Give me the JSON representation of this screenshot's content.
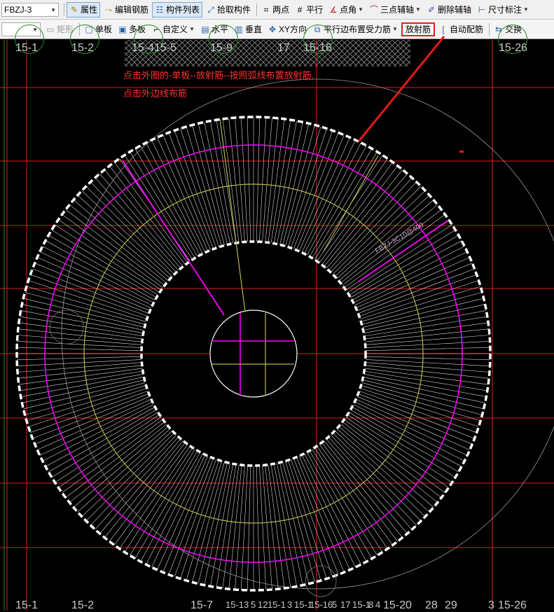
{
  "toolbar_top": {
    "component_select": "FBZJ-3",
    "buttons": [
      {
        "label": "属性",
        "icon": "properties-icon",
        "active": true
      },
      {
        "label": "编辑钢筋",
        "icon": "edit-rebar-icon",
        "active": false
      },
      {
        "label": "构件列表",
        "icon": "component-list-icon",
        "active": true
      },
      {
        "label": "拾取构件",
        "icon": "pick-component-icon",
        "active": false
      },
      {
        "label": "两点",
        "icon": "two-point-axis-icon",
        "active": false
      },
      {
        "label": "平行",
        "icon": "parallel-axis-icon",
        "active": false
      },
      {
        "label": "点角",
        "icon": "point-angle-axis-icon",
        "active": false
      },
      {
        "label": "三点辅轴",
        "icon": "three-point-axis-icon",
        "active": false
      },
      {
        "label": "删除辅轴",
        "icon": "delete-axis-icon",
        "active": false
      },
      {
        "label": "尺寸标注",
        "icon": "dimension-icon",
        "active": false
      }
    ]
  },
  "toolbar_bottom": {
    "shape_select": "",
    "buttons": [
      {
        "label": "矩形",
        "icon": "rectangle-icon",
        "disabled": true
      },
      {
        "label": "单板",
        "icon": "single-slab-icon"
      },
      {
        "label": "多板",
        "icon": "multi-slab-icon"
      },
      {
        "label": "自定义",
        "icon": "custom-icon"
      },
      {
        "label": "水平",
        "icon": "horizontal-icon"
      },
      {
        "label": "垂直",
        "icon": "vertical-icon"
      },
      {
        "label": "XY方向",
        "icon": "xy-direction-icon"
      },
      {
        "label": "平行边布置受力筋",
        "icon": "parallel-edge-icon"
      },
      {
        "label": "放射筋",
        "icon": "radial-rebar-icon",
        "highlighted": true
      },
      {
        "label": "自动配筋",
        "icon": "auto-rebar-icon"
      },
      {
        "label": "交换",
        "icon": "swap-icon"
      }
    ]
  },
  "canvas": {
    "axis_labels_top": [
      "15-1",
      "15-2",
      "15-4",
      "15-5",
      "15-9",
      "17",
      "15-16",
      "15-26"
    ],
    "axis_labels_bottom": [
      "15-1",
      "15-2",
      "15-7",
      "15-1",
      "3",
      "5",
      "12",
      "15-1",
      "3",
      "15-1",
      "15-16",
      "5",
      "17",
      "15-1",
      "8",
      "4",
      "15-20",
      "28",
      "29",
      "3",
      "15-26"
    ],
    "annotation_line1": "点击外圈的-单板--放射筋--按照弧线布置放射筋,",
    "annotation_line2": "点击外边线布筋",
    "rebar_label": "FBZJ-3C10@400",
    "colors": {
      "background": "#000000",
      "axis": "#e01a1a",
      "rebar": "#ffffff",
      "ring": "#ff00ff",
      "inner_ring": "#b8b84a",
      "annotation": "#ff3030"
    }
  }
}
